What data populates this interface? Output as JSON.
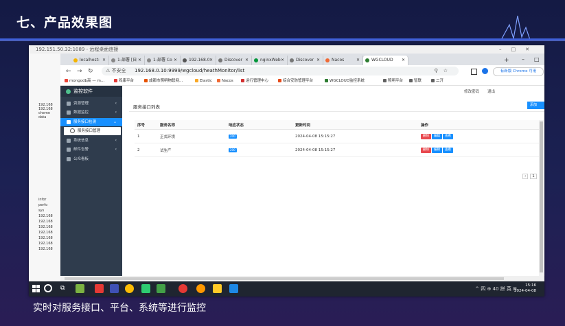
{
  "slide": {
    "title": "七、产品效果图",
    "caption": "实时对服务接口、平台、系统等进行监控"
  },
  "remote": {
    "title": "192.151.50.32:1089 - 远程桌面连接",
    "left_items": [
      "192.168",
      "192.168",
      "cheme",
      "data",
      "infor",
      "perfo",
      "sys",
      "192.168",
      "192.168",
      "192.168",
      "192.168",
      "192.168",
      "192.168",
      "192.168"
    ]
  },
  "browser": {
    "tabs": [
      {
        "label": "localhost:",
        "color": "#f4b400"
      },
      {
        "label": "1-部署 [日",
        "color": "#888888"
      },
      {
        "label": "1-部署 Co",
        "color": "#888888"
      },
      {
        "label": "192.168.0",
        "color": "#555555"
      },
      {
        "label": "Discover",
        "color": "#777777"
      },
      {
        "label": "nginxWeb",
        "color": "#009639"
      },
      {
        "label": "Discover",
        "color": "#777777"
      },
      {
        "label": "Nacos",
        "color": "#f06a35"
      },
      {
        "label": "WGCLOUD",
        "color": "#2e7d32"
      }
    ],
    "new_tab": "+",
    "not_secure": "⚠ 不安全",
    "url": "192.168.0.10:9999/wgcloud/heathMonitor/list",
    "update_button": "有新版 Chrome 可用",
    "bookmarks": [
      {
        "label": "mongodb高 — m...",
        "color": "#ea4335"
      },
      {
        "label": "鸡康平台",
        "color": "#e53935"
      },
      {
        "label": "成都市照明物联网...",
        "color": "#e65100"
      },
      {
        "label": "Elastic",
        "color": "#f9a825"
      },
      {
        "label": "Nacos",
        "color": "#f06a35"
      },
      {
        "label": "运行管理中心",
        "color": "#d32f2f"
      },
      {
        "label": "综合安防管理平台",
        "color": "#e64a19"
      },
      {
        "label": "WGCLOUD监控系统",
        "color": "#2e7d32"
      },
      {
        "label": "照明平台",
        "color": "#616161"
      },
      {
        "label": "智联",
        "color": "#616161"
      },
      {
        "label": "二开",
        "color": "#616161"
      }
    ]
  },
  "app": {
    "logo": "监控软件",
    "menu": [
      {
        "label": "资源管理",
        "arrow": "‹"
      },
      {
        "label": "数据监控",
        "arrow": "‹"
      },
      {
        "label": "服务接口检测",
        "arrow": "⌄"
      },
      {
        "label": "服务接口管理",
        "arrow": ""
      },
      {
        "label": "系统信息",
        "arrow": "‹"
      },
      {
        "label": "邮件告警",
        "arrow": "‹"
      },
      {
        "label": "公众看板",
        "arrow": ""
      }
    ],
    "top_links": {
      "password": "修改密码",
      "logout": "退出"
    },
    "panel_title": "服务接口列表",
    "add_button": "添加",
    "table": {
      "headers": [
        "序号",
        "服务名称",
        "响应状态",
        "更新时间",
        "操作"
      ],
      "rows": [
        {
          "no": "1",
          "name": "正式环境",
          "status": "200",
          "time": "2024-04-08 15:15:27"
        },
        {
          "no": "2",
          "name": "试生产",
          "status": "200",
          "time": "2024-04-08 15:15:27"
        }
      ],
      "actions": [
        "删除",
        "编辑",
        "查看"
      ]
    },
    "pager": {
      "prev": "‹",
      "page": "1"
    }
  },
  "taskbar": {
    "tray": "^ 四 ⊕ 40 拼 英 ⊞",
    "time": "15:16",
    "date": "2024-04-08"
  },
  "colors": {
    "accent": "#1890ff",
    "sidebar": "#2f3c4d",
    "danger": "#e8494f"
  }
}
